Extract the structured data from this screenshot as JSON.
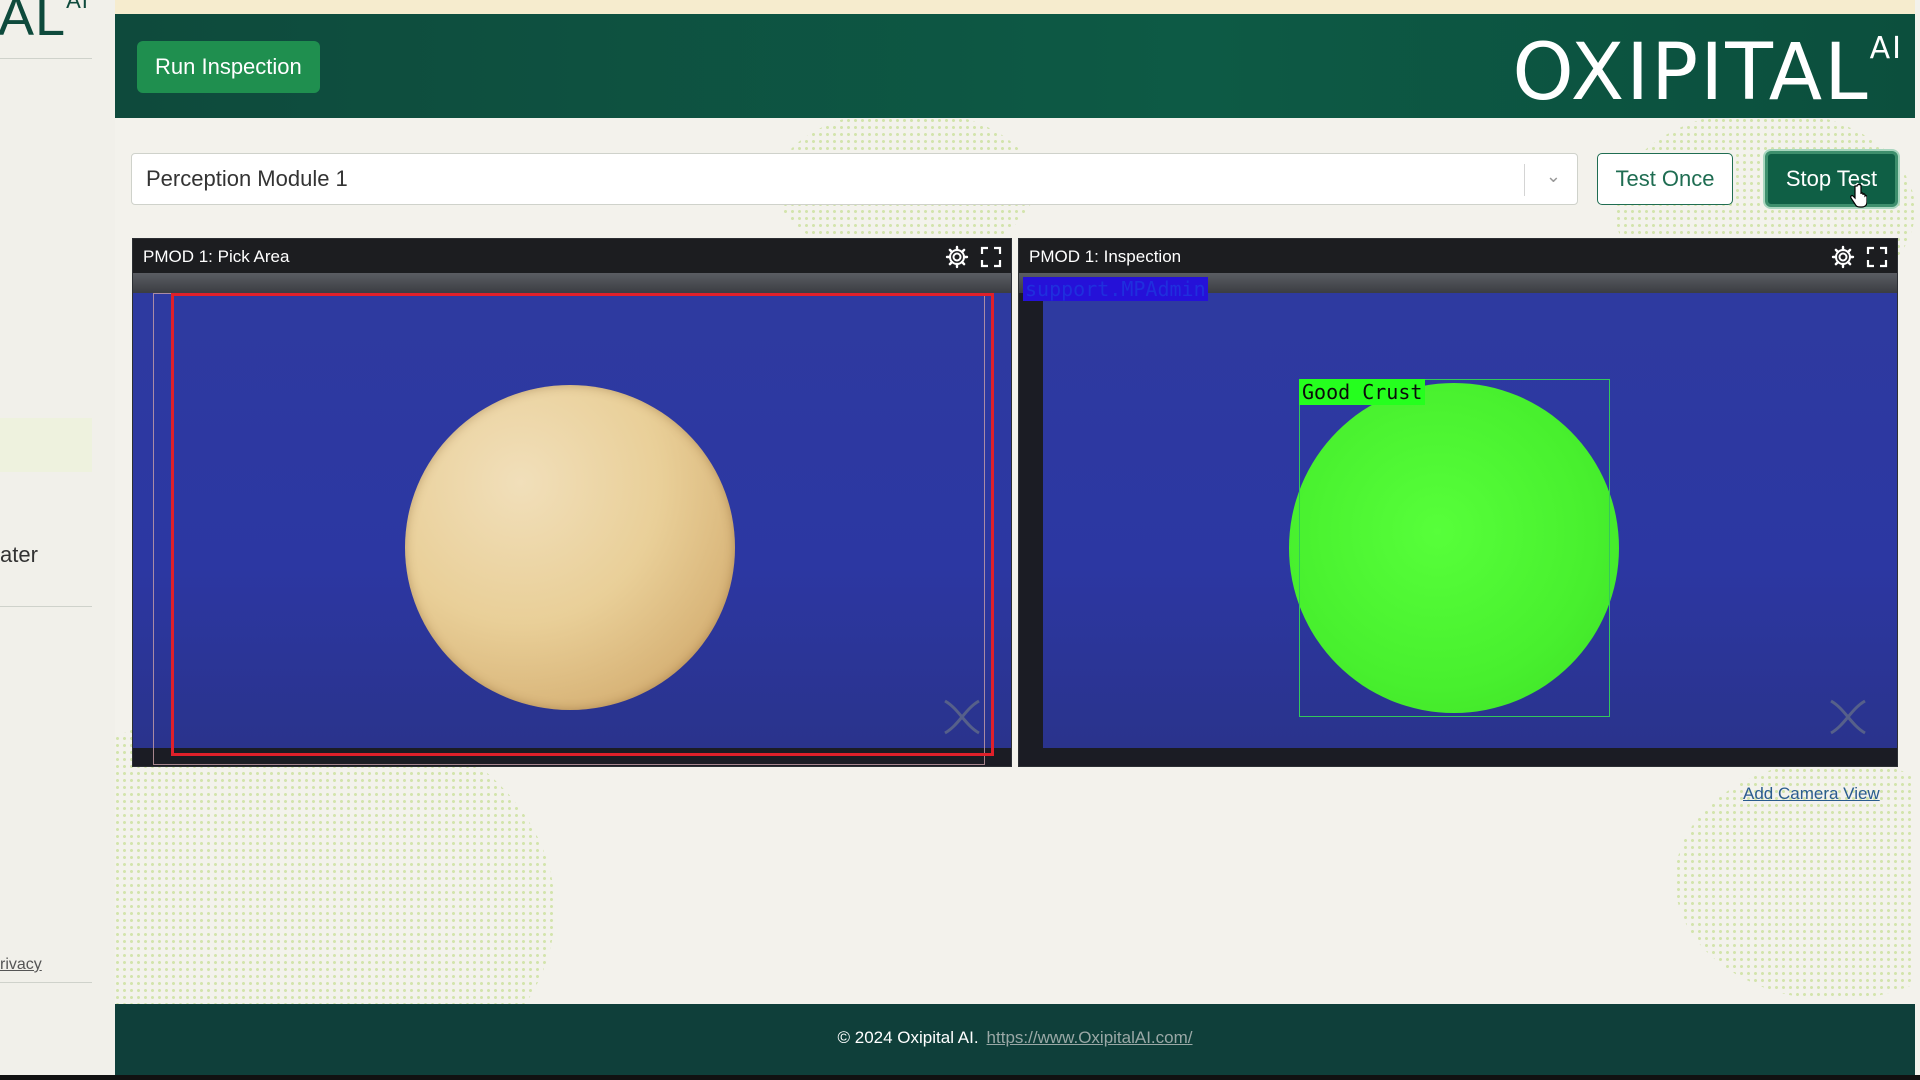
{
  "sidebar": {
    "logo_text": "AL",
    "logo_sup": "AI",
    "item_partial": "ater",
    "privacy_partial": "rivacy"
  },
  "toolbar": {
    "run_inspection_label": "Run Inspection"
  },
  "brand": {
    "name": "OXIPITAL",
    "sup": "AI"
  },
  "module_select": {
    "selected": "Perception Module 1",
    "options": [
      "Perception Module 1"
    ]
  },
  "actions": {
    "test_once_label": "Test Once",
    "stop_test_label": "Stop Test"
  },
  "cameras": [
    {
      "title": "PMOD 1: Pick Area",
      "icons": [
        "gear-icon",
        "fullscreen-icon"
      ]
    },
    {
      "title": "PMOD 1: Inspection",
      "icons": [
        "gear-icon",
        "fullscreen-icon"
      ],
      "overlay_label": "support.MPAdmin",
      "detection_label": "Good Crust"
    }
  ],
  "add_camera_label": "Add Camera View",
  "footer": {
    "copyright": "© 2024 Oxipital AI.",
    "link_text": "https://www.OxipitalAI.com/"
  },
  "colors": {
    "header": "#0e4a3c",
    "primary_button": "#1f8f4f",
    "stop_button": "#0f5f45",
    "pick_box": "#e0202a",
    "detection": "#25ff1e",
    "conveyor": "#2e3aa0"
  }
}
